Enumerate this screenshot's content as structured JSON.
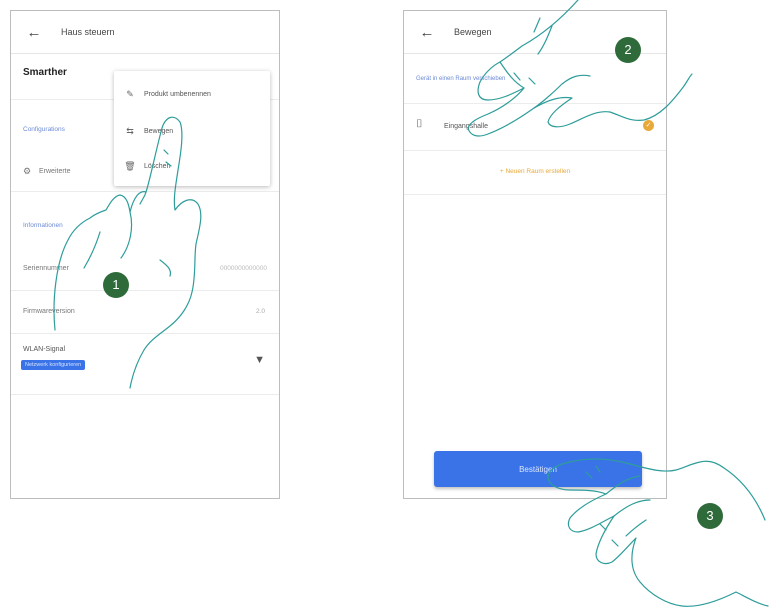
{
  "left_screen": {
    "title": "Haus steuern",
    "device_name": "Smarther",
    "config_section": "Configurations",
    "advanced_item": "Erweiterte",
    "info_section": "Informationen",
    "serial_label": "Seriennummer",
    "serial_value": "0000000000000",
    "firmware_label": "Firmwareversion",
    "firmware_value": "2.0",
    "wlan_label": "WLAN-Signal",
    "wlan_chip": "Netzwerk konfigurieren",
    "menu": [
      {
        "label": "Produkt umbenennen",
        "icon": "pencil-icon"
      },
      {
        "label": "Bewegen",
        "icon": "move-icon"
      },
      {
        "label": "Löschen",
        "icon": "trash-icon"
      }
    ]
  },
  "right_screen": {
    "title": "Bewegen",
    "info_text": "Gerät in einen Raum verschieben",
    "room_name": "Eingangshalle",
    "new_room_link": "Neuen Raum erstellen",
    "confirm_button": "Bestätigen"
  },
  "step_badges": [
    "1",
    "2",
    "3"
  ],
  "colors": {
    "accent": "#3a73e8",
    "badge": "#2f6b3a",
    "selected": "#e8a93a",
    "hand_outline": "#2e9d9a"
  }
}
